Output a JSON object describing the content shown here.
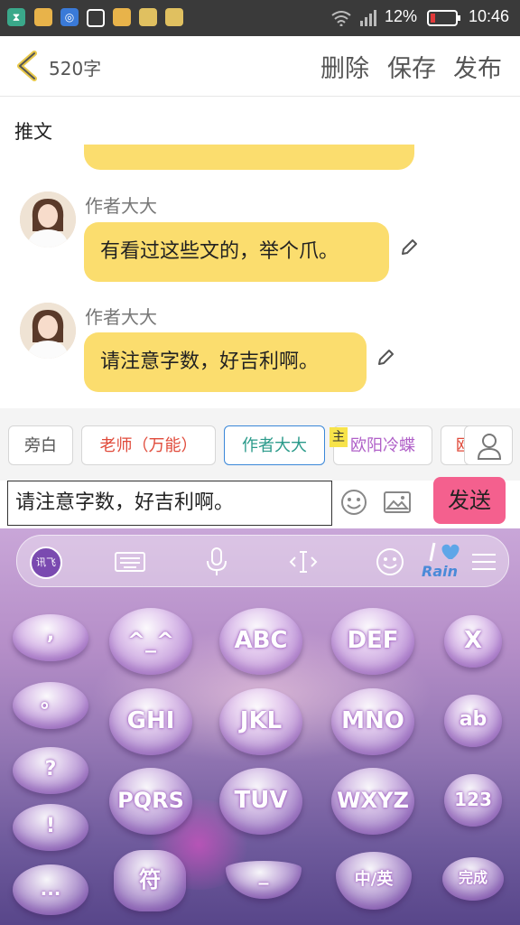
{
  "status_bar": {
    "battery_percent": "12%",
    "time": "10:46",
    "icons": [
      "hourglass-icon",
      "app-icon",
      "wifi-hotspot-icon",
      "screenshot-icon",
      "app-icon",
      "app-icon",
      "app-icon",
      "wifi-icon",
      "signal-icon",
      "battery-icon"
    ]
  },
  "header": {
    "word_count": "520字",
    "delete_label": "删除",
    "save_label": "保存",
    "publish_label": "发布"
  },
  "section_title": "推文",
  "messages": [
    {
      "author": "作者大大",
      "text": "有看过这些文的，举个爪。"
    },
    {
      "author": "作者大大",
      "text": "请注意字数，好吉利啊。"
    }
  ],
  "roles": {
    "narration": "旁白",
    "teacher": "老师（万能）",
    "author": "作者大大",
    "ouyang": "欧阳冷蝶",
    "host_badge": "主",
    "next_partial": "欧"
  },
  "input": {
    "value": "请注意字数，好吉利啊。",
    "send_label": "发送"
  },
  "keyboard": {
    "toolbar_logo": "讯飞",
    "rain_logo": "Rain",
    "keys": {
      "comma": ",",
      "period": "。",
      "question": "?",
      "exclaim": "!",
      "ellipsis": "...",
      "emoticon": "^_^",
      "abc": "ABC",
      "def": "DEF",
      "ghi": "GHI",
      "jkl": "JKL",
      "mno": "MNO",
      "pqrs": "PQRS",
      "tuv": "TUV",
      "wxyz": "WXYZ",
      "delete": "X",
      "ab": "ab",
      "num": "123",
      "symbol": "符",
      "space": "_",
      "lang": "中/英",
      "done": "完成"
    }
  },
  "colors": {
    "bubble": "#fbdd6e",
    "send_button": "#f4608e",
    "author_role_border": "#3a87d8",
    "teacher_role_text": "#e04a3a",
    "ouyang_role_text": "#b060c8"
  }
}
